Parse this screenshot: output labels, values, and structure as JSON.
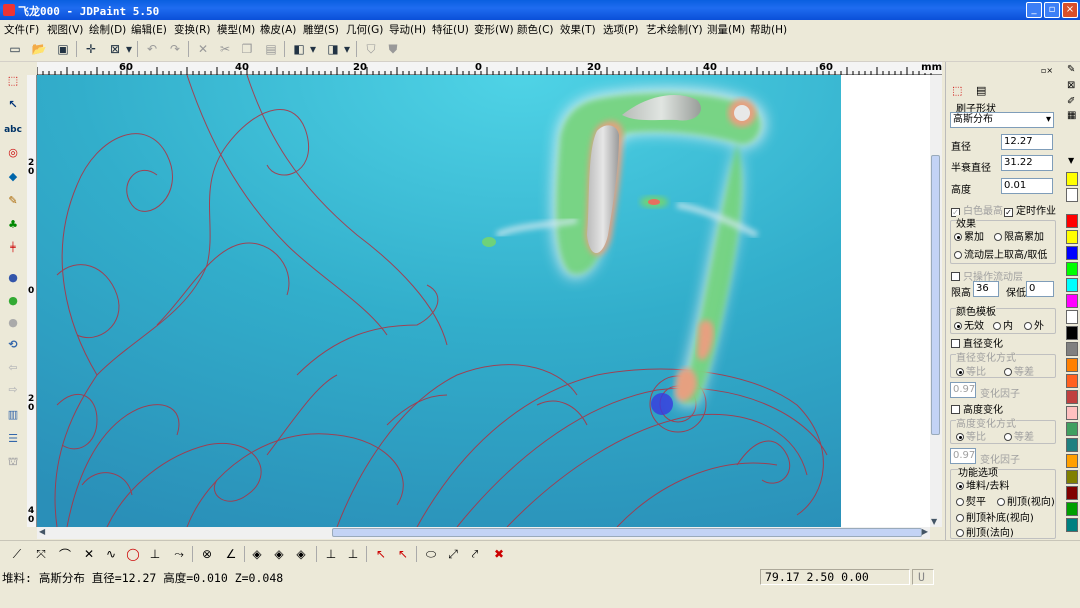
{
  "window": {
    "title": "飞龙000 - JDPaint 5.50",
    "min": "_",
    "max": "▫",
    "close": "×"
  },
  "menu": [
    "文件(F)",
    "视图(V)",
    "绘制(D)",
    "编辑(E)",
    "变换(R)",
    "模型(M)",
    "橡皮(A)",
    "雕塑(S)",
    "几何(G)",
    "导动(H)",
    "特征(U)",
    "变形(W)",
    "颜色(C)",
    "效果(T)",
    "选项(P)",
    "艺术绘制(Y)",
    "测量(M)",
    "帮助(H)"
  ],
  "ruler": {
    "h_labels": [
      "60",
      "40",
      "20",
      "0",
      "20",
      "40",
      "60"
    ],
    "unit": "mm",
    "v_labels": [
      "2\n0",
      "0",
      "2\n0",
      "4\n0"
    ]
  },
  "panel": {
    "brush_shape_label": "刷子形状",
    "brush_shape_value": "高斯分布",
    "diameter_label": "直径",
    "diameter_value": "12.27",
    "half_decay_label": "半衰直径",
    "half_decay_value": "31.22",
    "height_label": "高度",
    "height_value": "0.01",
    "white_highest": "白色最高",
    "timed_job": "定时作业",
    "effect_label": "效果",
    "effect_accum": "累加",
    "effect_limit_accum": "限高累加",
    "effect_flow": "流动层上取高/取低",
    "only_flow_layer": "只操作流动层",
    "limit_high_label": "限高",
    "limit_high_value": "36",
    "keep_low_label": "保低",
    "keep_low_value": "0",
    "color_template_label": "颜色模板",
    "tpl_none": "无效",
    "tpl_inner": "内",
    "tpl_outer": "外",
    "diameter_change": "直径变化",
    "diameter_change_mode": "直径变化方式",
    "ratio": "等比",
    "diff": "等差",
    "factor_value": "0.97",
    "factor_label": "变化因子",
    "height_change": "高度变化",
    "height_change_mode": "高度变化方式",
    "func_label": "功能选项",
    "func_add_remove": "堆料/去料",
    "func_flatten": "熨平",
    "func_cut_view": "削顶(视向)",
    "func_cut_fill": "削顶补底(视向)",
    "func_cut_normal": "削顶(法向)"
  },
  "palette_colors": [
    "#ffff00",
    "#ffffff",
    "#ff0000",
    "#ffff00",
    "#0000ff",
    "#00ff00",
    "#00ffff",
    "#ff00ff",
    "#ffffff",
    "#000000",
    "#808080",
    "#ff8000",
    "#ff6020",
    "#c04040",
    "#ffc0c0",
    "#40a060",
    "#208080",
    "#ffa000",
    "#808000",
    "#800000",
    "#00a000",
    "#008080",
    "#006000",
    "#800080",
    "#400080"
  ],
  "status": {
    "text": "堆料: 高斯分布  直径=12.27  高度=0.010  Z=0.048",
    "coords": "79.17 2.50 0.00",
    "mode": "U"
  }
}
